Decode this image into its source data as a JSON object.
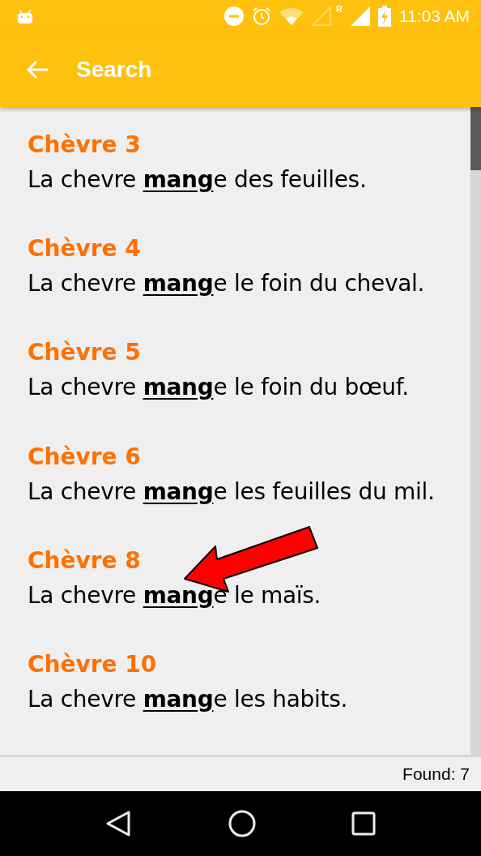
{
  "status_bar": {
    "time": "11:03 AM",
    "roaming_mark": "R"
  },
  "toolbar": {
    "title": "Search"
  },
  "results": [
    {
      "title": "Chèvre 3",
      "sentence": "La chevre **mang**e des feuilles."
    },
    {
      "title": "Chèvre 4",
      "sentence": "La chevre **mang**e le foin du cheval."
    },
    {
      "title": "Chèvre 5",
      "sentence": "La chevre **mang**e le foin du bœuf."
    },
    {
      "title": "Chèvre 6",
      "sentence": "La chevre **mang**e les feuilles du mil."
    },
    {
      "title": "Chèvre 8",
      "sentence": "La chevre **mang**e le maïs."
    },
    {
      "title": "Chèvre 10",
      "sentence": "La chevre **mang**e les habits."
    }
  ],
  "footer": {
    "found": "Found: 7"
  }
}
